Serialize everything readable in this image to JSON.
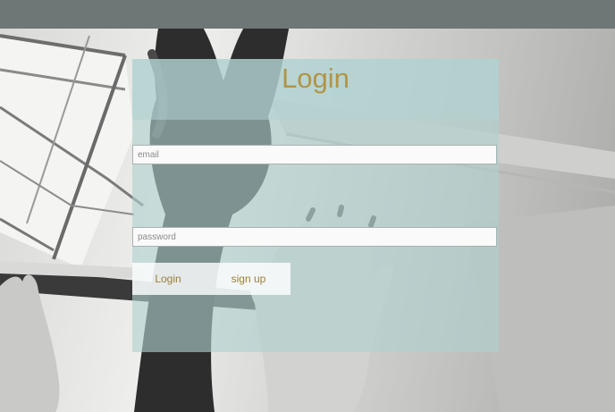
{
  "page": {
    "title": "Login"
  },
  "form": {
    "email": {
      "placeholder": "email",
      "value": ""
    },
    "password": {
      "placeholder": "password",
      "value": ""
    },
    "login_label": "Login",
    "signup_label": "sign up"
  },
  "colors": {
    "accent": "#b09447",
    "panel": "#b0d0ce",
    "topbar": "#6e7676"
  },
  "icons": {
    "background": "background-photo"
  }
}
